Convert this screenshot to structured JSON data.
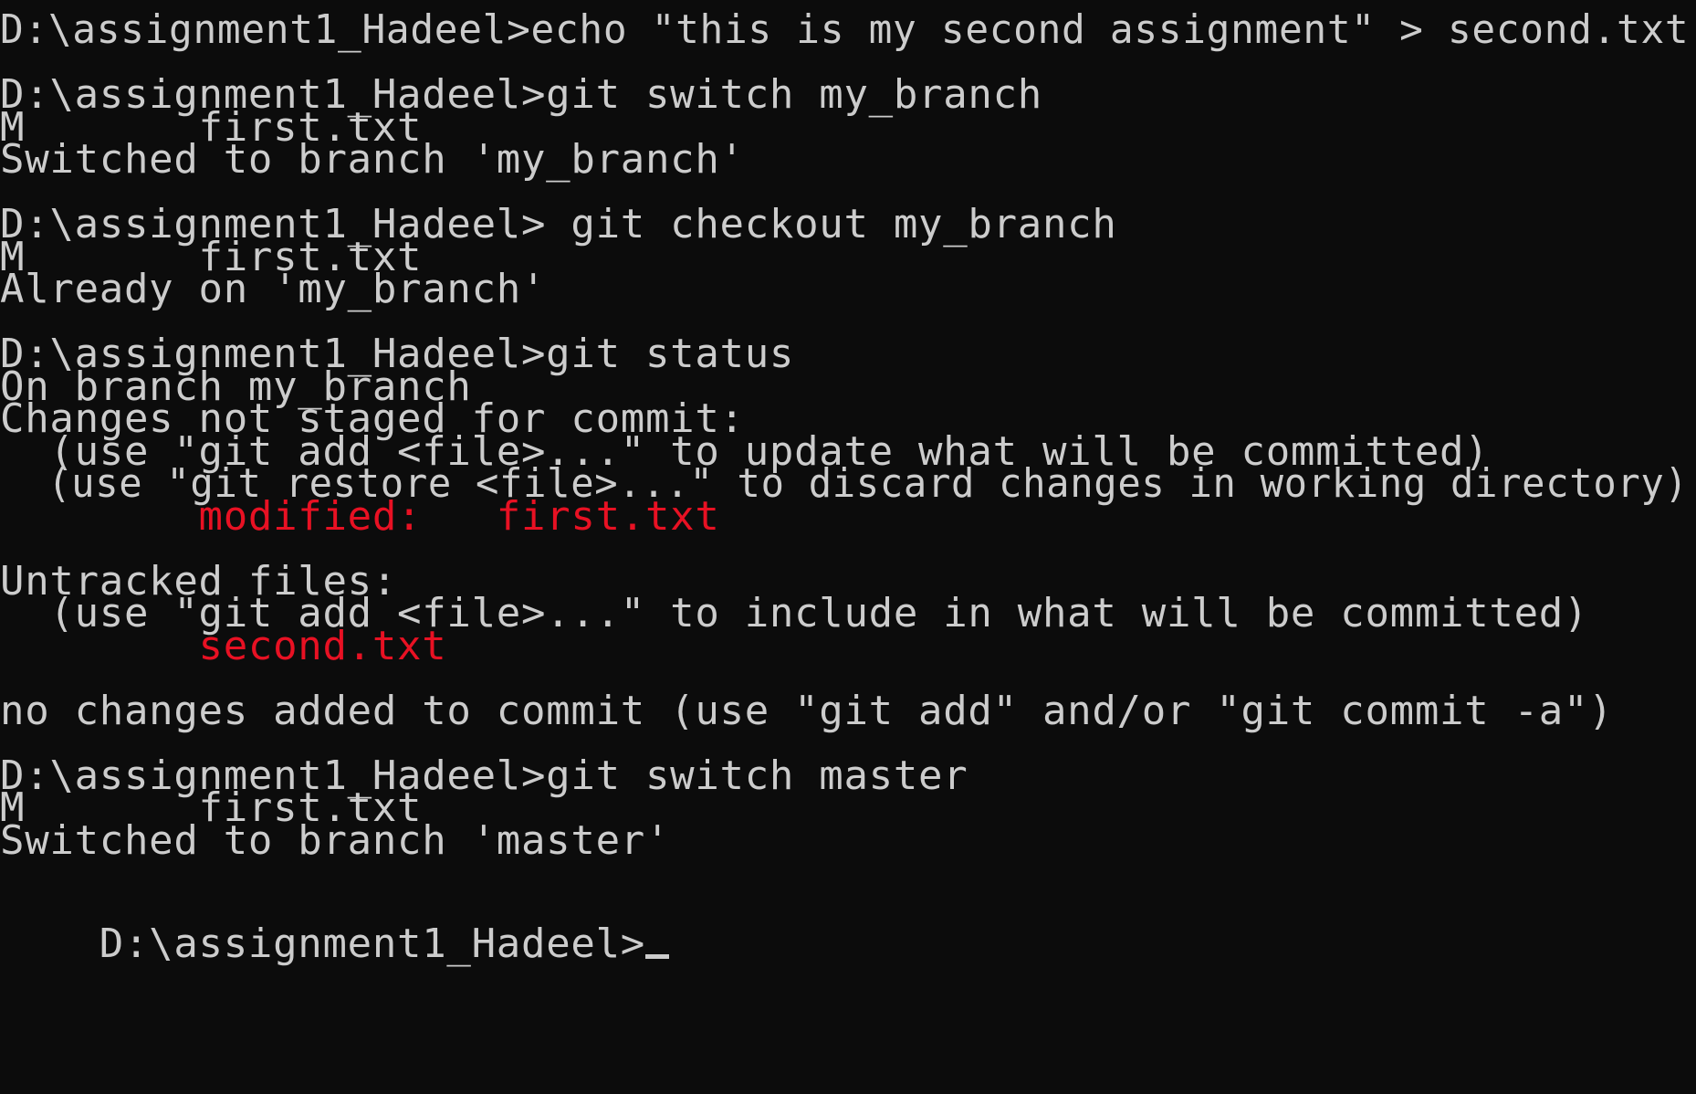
{
  "colors": {
    "background": "#0c0c0c",
    "text": "#cccccc",
    "status_red": "#e81123"
  },
  "prompt": "D:\\assignment1_Hadeel>",
  "lines": [
    {
      "text": "D:\\assignment1_Hadeel>echo \"this is my second assignment\" > second.txt",
      "color": "default"
    },
    {
      "text": "",
      "color": "default"
    },
    {
      "text": "D:\\assignment1_Hadeel>git switch my_branch",
      "color": "default"
    },
    {
      "text": "M       first.txt",
      "color": "default"
    },
    {
      "text": "Switched to branch 'my_branch'",
      "color": "default"
    },
    {
      "text": "",
      "color": "default"
    },
    {
      "text": "D:\\assignment1_Hadeel> git checkout my_branch",
      "color": "default"
    },
    {
      "text": "M       first.txt",
      "color": "default"
    },
    {
      "text": "Already on 'my_branch'",
      "color": "default"
    },
    {
      "text": "",
      "color": "default"
    },
    {
      "text": "D:\\assignment1_Hadeel>git status",
      "color": "default"
    },
    {
      "text": "On branch my_branch",
      "color": "default"
    },
    {
      "text": "Changes not staged for commit:",
      "color": "default"
    },
    {
      "text": "  (use \"git add <file>...\" to update what will be committed)",
      "color": "default"
    },
    {
      "text": "  (use \"git restore <file>...\" to discard changes in working directory)",
      "color": "default"
    },
    {
      "text": "        modified:   first.txt",
      "color": "red"
    },
    {
      "text": "",
      "color": "default"
    },
    {
      "text": "Untracked files:",
      "color": "default"
    },
    {
      "text": "  (use \"git add <file>...\" to include in what will be committed)",
      "color": "default"
    },
    {
      "text": "        second.txt",
      "color": "red"
    },
    {
      "text": "",
      "color": "default"
    },
    {
      "text": "no changes added to commit (use \"git add\" and/or \"git commit -a\")",
      "color": "default"
    },
    {
      "text": "",
      "color": "default"
    },
    {
      "text": "D:\\assignment1_Hadeel>git switch master",
      "color": "default"
    },
    {
      "text": "M       first.txt",
      "color": "default"
    },
    {
      "text": "Switched to branch 'master'",
      "color": "default"
    },
    {
      "text": "",
      "color": "default"
    }
  ]
}
